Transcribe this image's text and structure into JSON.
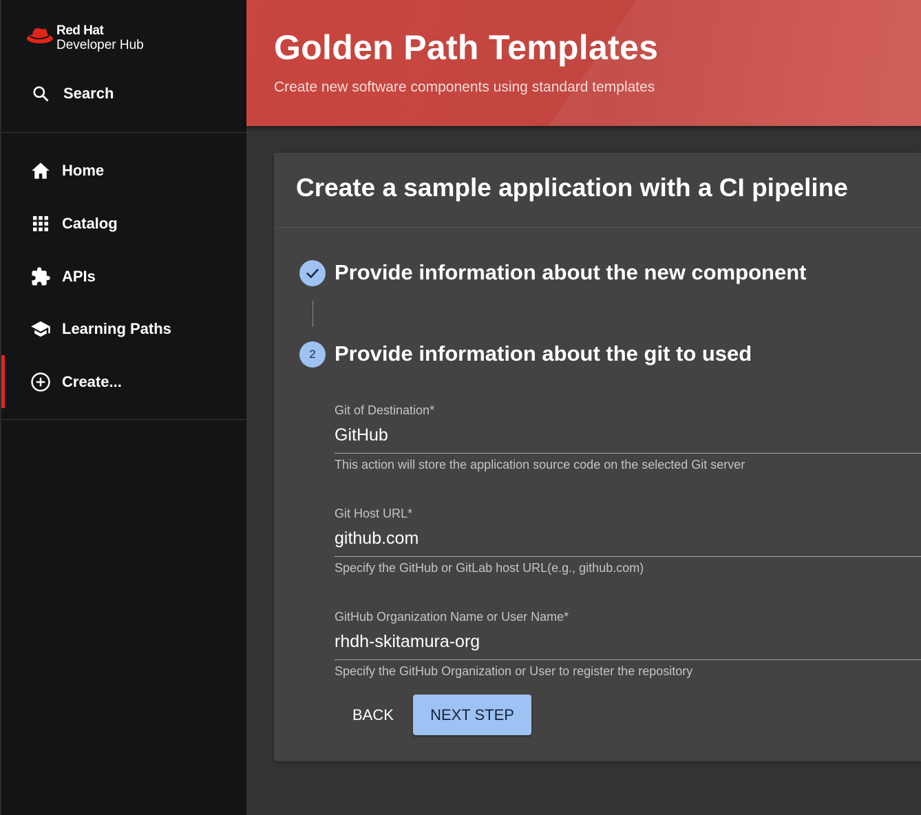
{
  "app": {
    "brand_line1": "Red Hat",
    "brand_line2": "Developer Hub",
    "brand_color": "#e1251b"
  },
  "sidebar": {
    "search_label": "Search",
    "items": [
      {
        "label": "Home",
        "icon": "home-icon"
      },
      {
        "label": "Catalog",
        "icon": "grid-icon"
      },
      {
        "label": "APIs",
        "icon": "puzzle-icon"
      },
      {
        "label": "Learning Paths",
        "icon": "school-icon"
      },
      {
        "label": "Create...",
        "icon": "add-circle-icon",
        "active": true
      }
    ]
  },
  "header": {
    "title": "Golden Path Templates",
    "subtitle": "Create new software components using standard templates"
  },
  "wizard": {
    "title": "Create a sample application with a CI pipeline",
    "steps": [
      {
        "label": "Provide information about the new component",
        "status": "completed"
      },
      {
        "number": "2",
        "label": "Provide information about the git to used",
        "status": "active"
      }
    ],
    "fields": [
      {
        "label": "Git of Destination*",
        "value": "GitHub",
        "help": "This action will store the application source code on the selected Git server"
      },
      {
        "label": "Git Host URL*",
        "value": "github.com",
        "help": "Specify the GitHub or GitLab host URL(e.g., github.com)"
      },
      {
        "label": "GitHub Organization Name or User Name*",
        "value": "rhdh-skitamura-org",
        "help": "Specify the GitHub Organization or User to register the repository"
      }
    ],
    "back_label": "BACK",
    "next_label": "NEXT STEP"
  }
}
